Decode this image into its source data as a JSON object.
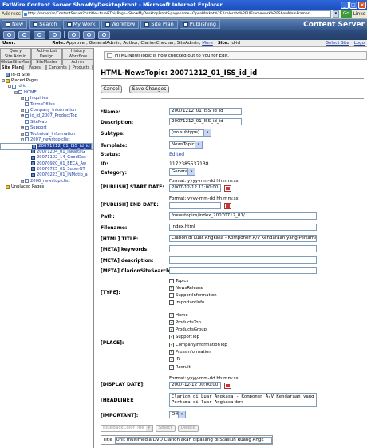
{
  "window": {
    "title": "FatWire Content Server ShowMyDesktopFront - Microsoft Internet Explorer"
  },
  "address_bar": {
    "label": "Address",
    "url": "http://server/cs/ContentServer?cs.title=true&ThisPage=ShowMyDesktopFront&pagename=OpenMarket%2FXcelerate%2FUIFramework%2FShowMainFrames",
    "go_label": "Go",
    "links_label": "Links"
  },
  "app_toolbar": {
    "buttons": [
      "New",
      "Search",
      "My Work",
      "Workflow",
      "Site Plan",
      "Publishing"
    ],
    "brand": "Content Server"
  },
  "user_bar": {
    "user_label": "User:",
    "role_label": "Role:",
    "roles": "Approver, GeneralAdmin, Author, ClarionChecker, SiteAdmin,",
    "more_label": "More",
    "site_label": "Site:",
    "site": "id-id",
    "select_site": "Select Site",
    "logout": "Logo"
  },
  "left_panel": {
    "tabs_row1": [
      "Query",
      "Active List",
      "History"
    ],
    "tabs_row2": [
      "Site Admin",
      "Design",
      "Workflow"
    ],
    "tabs_row3": [
      "GlobalSiteMaster",
      "SiteMaster",
      "Admin"
    ],
    "tabs_row4": [
      "Site Plan",
      "Pages",
      "Contents",
      "Products"
    ],
    "active_tab": "Site Plan",
    "tree": [
      {
        "label": "id-id Site",
        "depth": 0,
        "toggle": "",
        "icon": "site",
        "link": false
      },
      {
        "label": "Placed Pages",
        "depth": 0,
        "toggle": "-",
        "icon": "folder",
        "link": false
      },
      {
        "label": "id-id",
        "depth": 1,
        "toggle": "-",
        "icon": "page",
        "link": true
      },
      {
        "label": "HOME",
        "depth": 2,
        "toggle": "-",
        "icon": "page",
        "link": true
      },
      {
        "label": "Inquiries",
        "depth": 3,
        "toggle": "+",
        "icon": "page",
        "link": true
      },
      {
        "label": "TermsOfUse",
        "depth": 3,
        "toggle": "",
        "icon": "page",
        "link": true
      },
      {
        "label": "Company_Information",
        "depth": 3,
        "toggle": "+",
        "icon": "page",
        "link": true
      },
      {
        "label": "id_id_2007_ProductTop",
        "depth": 3,
        "toggle": "+",
        "icon": "page",
        "link": true
      },
      {
        "label": "SiteMap",
        "depth": 3,
        "toggle": "",
        "icon": "page",
        "link": true
      },
      {
        "label": "Support",
        "depth": 3,
        "toggle": "+",
        "icon": "page",
        "link": true
      },
      {
        "label": "Technical_Information",
        "depth": 3,
        "toggle": "+",
        "icon": "page",
        "link": true
      },
      {
        "label": "2007_newstopiclist",
        "depth": 3,
        "toggle": "-",
        "icon": "page",
        "link": true
      },
      {
        "label": "20071212_01_ISS_id_id",
        "depth": 4,
        "toggle": "",
        "icon": "nt",
        "link": true,
        "selected": true
      },
      {
        "label": "20071210_01_NewProd",
        "depth": 4,
        "toggle": "",
        "icon": "nt",
        "link": true
      },
      {
        "label": "20071204_01_JakartaG",
        "depth": 4,
        "toggle": "",
        "icon": "nt",
        "link": true
      },
      {
        "label": "20071102_14_GoodDes",
        "depth": 4,
        "toggle": "",
        "icon": "nt",
        "link": true
      },
      {
        "label": "20070920_01_EECA_Aw",
        "depth": 4,
        "toggle": "",
        "icon": "nt",
        "link": true
      },
      {
        "label": "20070725_01_SuperOT",
        "depth": 4,
        "toggle": "",
        "icon": "nt",
        "link": true
      },
      {
        "label": "20070223_01_INMotio_a",
        "depth": 4,
        "toggle": "",
        "icon": "nt",
        "link": true
      },
      {
        "label": "2006_newstopiclist",
        "depth": 3,
        "toggle": "+",
        "icon": "page",
        "link": true
      },
      {
        "label": "Unplaced Pages",
        "depth": 0,
        "toggle": "",
        "icon": "folder",
        "link": false
      }
    ]
  },
  "content": {
    "notice": "HTML-NewsTopic is now checked out to you for Edit.",
    "page_title": "HTML-NewsTopic: 20071212_01_ISS_id_id",
    "cancel_label": "Cancel",
    "save_label": "Save Changes",
    "fields": {
      "name_label": "*Name:",
      "name_value": "20071212_01_ISS_id_id",
      "description_label": "Description:",
      "description_value": "20071212_01_ISS_id_id",
      "subtype_label": "Subtype:",
      "subtype_value": "(no subtype)",
      "template_label": "Template:",
      "template_value": "NewsTopic",
      "status_label": "Status:",
      "status_value": "Edited",
      "id_label": "ID:",
      "id_value": "1172385537138",
      "category_label": "Category:",
      "category_value": "General",
      "pub_start_label": "[PUBLISH] START DATE:",
      "pub_start_format": "Format: yyyy-mm-dd hh:mm:ss",
      "pub_start_value": "2007-12-12 11:00:00",
      "pub_end_label": "[PUBLISH] END DATE:",
      "pub_end_format": "Format: yyyy-mm-dd hh:mm:ss",
      "pub_end_value": "",
      "path_label": "Path:",
      "path_value": "/newstopics/index_20070712_01/",
      "filename_label": "Filename:",
      "filename_value": "index.html",
      "html_title_label": "[HTML] TITLE:",
      "html_title_value": "Clarion di Luar Angkasa - Komponen A/V Kendaraan yang Pertama",
      "meta_keywords_label": "[META] keywords:",
      "meta_keywords_value": "",
      "meta_description_label": "[META] description:",
      "meta_description_value": "",
      "meta_clarion_label": "[META] ClarionSiteSearch:",
      "meta_clarion_value": "",
      "type_label": "[TYPE]:",
      "type_options": [
        {
          "label": "Topics",
          "checked": false
        },
        {
          "label": "NewsRelease",
          "checked": true
        },
        {
          "label": "SupportInformation",
          "checked": false
        },
        {
          "label": "ImportantInfo",
          "checked": false
        }
      ],
      "place_label": "[PLACE]:",
      "place_options": [
        {
          "label": "Home",
          "checked": true
        },
        {
          "label": "ProductsTop",
          "checked": true
        },
        {
          "label": "ProductsGroup",
          "checked": true
        },
        {
          "label": "SupportTop",
          "checked": true
        },
        {
          "label": "CompanyInformationTop",
          "checked": true
        },
        {
          "label": "PressInformation",
          "checked": true
        },
        {
          "label": "IR",
          "checked": true
        },
        {
          "label": "Recruit",
          "checked": true
        }
      ],
      "display_date_label": "[DISPLAY DATE]:",
      "display_date_format": "Format: yyyy-mm-dd hh:mm:ss",
      "display_date_value": "2007-12-12 00:00:00",
      "headline_label": "[HEADLINE]:",
      "headline_value": "Clarion di Luar Angkasa - Komponen A/V Kendaraan yang Pertama di luar Angkasa<br>",
      "important_label": "[IMPORTANT]:",
      "important_value": "Off"
    },
    "bottom": {
      "color_select": "BlueBackColorTitle",
      "select_label": "Select",
      "delete_label": "Delete",
      "title_label": "Title",
      "title_value": "Unit multimedia DVD Clarion akan dipasang di Stasiun Ruang Angk"
    }
  }
}
